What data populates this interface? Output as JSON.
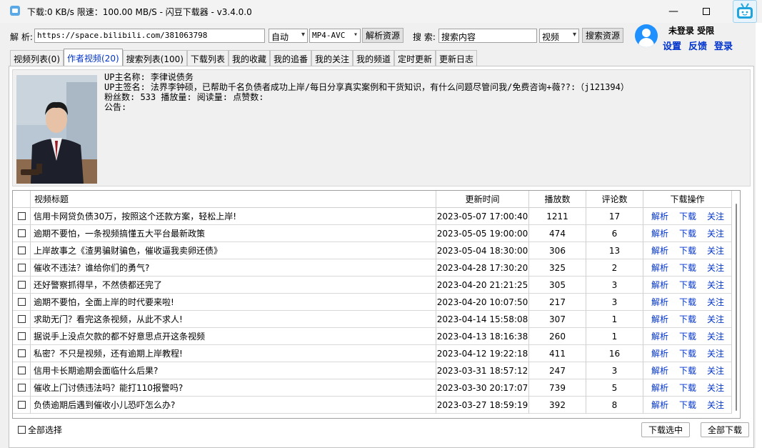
{
  "window": {
    "title": "下载:0 KB/s   限速：100.00 MB/S  - 闪豆下载器 - v3.4.0.0",
    "minimize_label": "—"
  },
  "toolbar": {
    "parse_label": "解 析:",
    "url_value": "https://space.bilibili.com/381063798",
    "quality_value": "自动",
    "format_value": "MP4-AVC",
    "parse_button": "解析资源",
    "search_label": "搜 索:",
    "search_value": "搜索内容",
    "search_type_value": "视频",
    "search_button": "搜索资源"
  },
  "account": {
    "status": "未登录  受限",
    "settings": "设置",
    "feedback": "反馈",
    "login": "登录"
  },
  "tabs": [
    {
      "label": "视频列表(0)"
    },
    {
      "label": "作者视频(20)"
    },
    {
      "label": "搜索列表(100)"
    },
    {
      "label": "下载列表"
    },
    {
      "label": "我的收藏"
    },
    {
      "label": "我的追番"
    },
    {
      "label": "我的关注"
    },
    {
      "label": "我的频道"
    },
    {
      "label": "定时更新"
    },
    {
      "label": "更新日志"
    }
  ],
  "profile": {
    "name_line": "UP主名称: 李律说债务",
    "sign_line": "UP主签名: 法界李钟硕，已帮助千名负债者成功上岸/每日分享真实案例和干货知识，有什么问题尽管问我/免费咨询+薇??:（j121394）",
    "stats_line": "粉丝数: 533  播放量:   阅读量:   点赞数:",
    "notice_line": "公告:"
  },
  "table": {
    "headers": {
      "title": "视频标题",
      "time": "更新时间",
      "plays": "播放数",
      "comments": "评论数",
      "ops": "下载操作"
    },
    "op_labels": {
      "parse": "解析",
      "download": "下载",
      "follow": "关注"
    },
    "rows": [
      {
        "title": "信用卡网贷负债30万，按照这个还款方案，轻松上岸!",
        "time": "2023-05-07 17:00:40",
        "plays": "1211",
        "comments": "17"
      },
      {
        "title": "逾期不要怕，一条视频搞懂五大平台最新政策",
        "time": "2023-05-05 19:00:00",
        "plays": "474",
        "comments": "6"
      },
      {
        "title": "上岸故事之《渣男骗财骗色，催收逼我卖卵还债》",
        "time": "2023-05-04 18:30:00",
        "plays": "306",
        "comments": "13"
      },
      {
        "title": "催收不违法？谁给你们的勇气?",
        "time": "2023-04-28 17:30:20",
        "plays": "325",
        "comments": "2"
      },
      {
        "title": "还好警察抓得早，不然债都还完了",
        "time": "2023-04-20 21:21:25",
        "plays": "305",
        "comments": "3"
      },
      {
        "title": "逾期不要怕，全面上岸的时代要来啦!",
        "time": "2023-04-20 10:07:50",
        "plays": "217",
        "comments": "3"
      },
      {
        "title": "求助无门？看完这条视频，从此不求人!",
        "time": "2023-04-14 15:58:08",
        "plays": "307",
        "comments": "1"
      },
      {
        "title": "据说手上没点欠款的都不好意思点开这条视频",
        "time": "2023-04-13 18:16:38",
        "plays": "260",
        "comments": "1"
      },
      {
        "title": "私密？不只是视频，还有逾期上岸教程!",
        "time": "2023-04-12 19:22:18",
        "plays": "411",
        "comments": "16"
      },
      {
        "title": "信用卡长期逾期会面临什么后果?",
        "time": "2023-03-31 18:57:12",
        "plays": "247",
        "comments": "3"
      },
      {
        "title": "催收上门讨债违法吗？能打110报警吗?",
        "time": "2023-03-30 20:17:07",
        "plays": "739",
        "comments": "5"
      },
      {
        "title": "负债逾期后遇到催收小儿恐吓怎么办?",
        "time": "2023-03-27 18:59:19",
        "plays": "392",
        "comments": "8"
      }
    ]
  },
  "bottom": {
    "select_all": "全部选择",
    "download_selected": "下载选中",
    "download_all": "全部下载"
  }
}
